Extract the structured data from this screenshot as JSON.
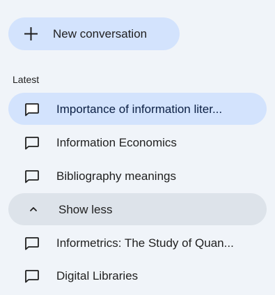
{
  "new_conversation": {
    "label": "New conversation",
    "icon": "plus-icon"
  },
  "section": {
    "label": "Latest"
  },
  "conversations": [
    {
      "label": "Importance of information liter...",
      "icon": "chat-bubble-icon",
      "active": true
    },
    {
      "label": "Information Economics",
      "icon": "chat-bubble-icon",
      "active": false
    },
    {
      "label": "Bibliography meanings",
      "icon": "chat-bubble-icon",
      "active": false
    }
  ],
  "show_less": {
    "label": "Show less",
    "icon": "chevron-up-icon"
  },
  "more_conversations": [
    {
      "label": "Informetrics: The Study of Quan...",
      "icon": "chat-bubble-icon"
    },
    {
      "label": "Digital Libraries",
      "icon": "chat-bubble-icon"
    }
  ],
  "colors": {
    "background": "#f0f4f9",
    "accent": "#d3e3fd",
    "show_less_bg": "#dde3ea",
    "text": "#1f1f1f"
  }
}
